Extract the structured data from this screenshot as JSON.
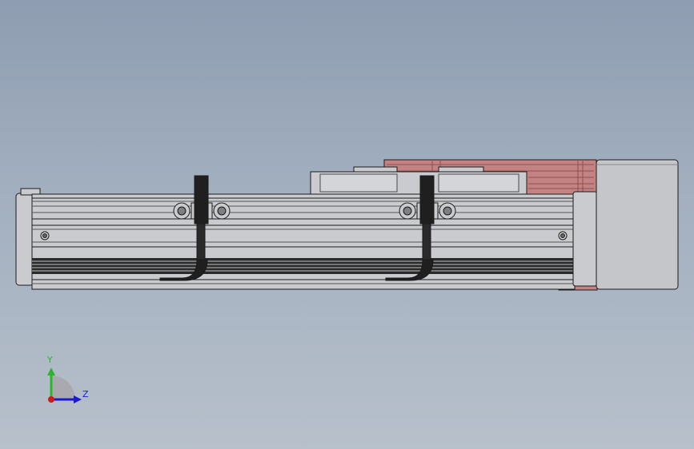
{
  "triad": {
    "y_label": "Y",
    "z_label": "Z",
    "y_color": "#2bb52b",
    "z_color": "#1a1ad0",
    "x_color": "#cc1a1a"
  },
  "colors": {
    "background_top": "#8e9db1",
    "background_bottom": "#b7c0cb",
    "body": "#c9cbce",
    "outline": "#1b1b1b",
    "bracket": "#1f1f1f",
    "motor_highlight": "#c48383",
    "motor_housing": "#c4c6c9"
  }
}
